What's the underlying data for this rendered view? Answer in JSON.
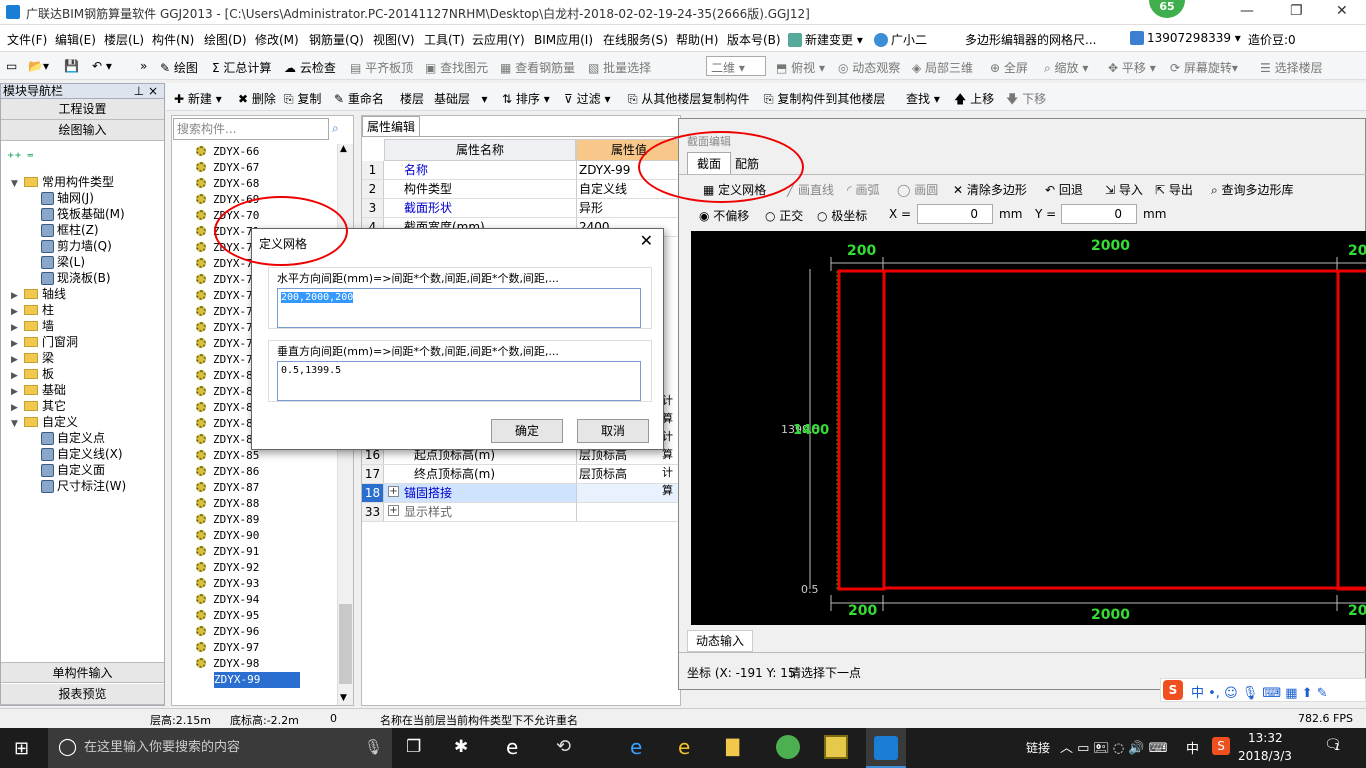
{
  "window": {
    "title": "广联达BIM钢筋算量软件 GGJ2013 - [C:\\Users\\Administrator.PC-20141127NRHM\\Desktop\\白龙村-2018-02-02-19-24-35(2666版).GGJ12]",
    "badge": "65"
  },
  "menu": [
    "文件(F)",
    "编辑(E)",
    "楼层(L)",
    "构件(N)",
    "绘图(D)",
    "修改(M)",
    "钢筋量(Q)",
    "视图(V)",
    "工具(T)",
    "云应用(Y)",
    "BIM应用(I)",
    "在线服务(S)",
    "帮助(H)",
    "版本号(B)",
    "新建变更",
    "广小二",
    "多边形编辑器的网格尺...",
    "13907298339",
    "造价豆:0"
  ],
  "toolbar1": [
    "绘图",
    "汇总计算",
    "云检查",
    "平齐板顶",
    "查找图元",
    "查看钢筋量",
    "批量选择",
    "二维",
    "俯视",
    "动态观察",
    "局部三维",
    "全屏",
    "缩放",
    "平移",
    "屏幕旋转",
    "选择楼层"
  ],
  "toolbar2": [
    "新建",
    "删除",
    "复制",
    "重命名",
    "楼层",
    "基础层",
    "排序",
    "过滤",
    "从其他楼层复制构件",
    "复制构件到其他楼层",
    "查找",
    "上移",
    "下移"
  ],
  "nav": {
    "title": "模块导航栏",
    "top_buttons": [
      "工程设置",
      "绘图输入"
    ],
    "bottom_buttons": [
      "单构件输入",
      "报表预览"
    ],
    "tree": [
      {
        "label": "常用构件类型",
        "level": 0,
        "exp": "▼"
      },
      {
        "label": "轴网(J)",
        "level": 1
      },
      {
        "label": "筏板基础(M)",
        "level": 1
      },
      {
        "label": "框柱(Z)",
        "level": 1
      },
      {
        "label": "剪力墙(Q)",
        "level": 1
      },
      {
        "label": "梁(L)",
        "level": 1
      },
      {
        "label": "现浇板(B)",
        "level": 1
      },
      {
        "label": "轴线",
        "level": 0,
        "exp": "▶"
      },
      {
        "label": "柱",
        "level": 0,
        "exp": "▶"
      },
      {
        "label": "墙",
        "level": 0,
        "exp": "▶"
      },
      {
        "label": "门窗洞",
        "level": 0,
        "exp": "▶"
      },
      {
        "label": "梁",
        "level": 0,
        "exp": "▶"
      },
      {
        "label": "板",
        "level": 0,
        "exp": "▶"
      },
      {
        "label": "基础",
        "level": 0,
        "exp": "▶"
      },
      {
        "label": "其它",
        "level": 0,
        "exp": "▶"
      },
      {
        "label": "自定义",
        "level": 0,
        "exp": "▼"
      },
      {
        "label": "自定义点",
        "level": 1
      },
      {
        "label": "自定义线(X)",
        "level": 1
      },
      {
        "label": "自定义面",
        "level": 1
      },
      {
        "label": "尺寸标注(W)",
        "level": 1
      }
    ]
  },
  "components": {
    "search_placeholder": "搜索构件...",
    "items": [
      "ZDYX-66",
      "ZDYX-67",
      "ZDYX-68",
      "ZDYX-69",
      "ZDYX-70",
      "ZDYX-71",
      "ZDYX-72",
      "ZDYX-73",
      "ZDYX-74",
      "ZDYX-75",
      "ZDYX-76",
      "ZDYX-77",
      "ZDYX-78",
      "ZDYX-79",
      "ZDYX-80",
      "ZDYX-81",
      "ZDYX-82",
      "ZDYX-83",
      "ZDYX-84",
      "ZDYX-85",
      "ZDYX-86",
      "ZDYX-87",
      "ZDYX-88",
      "ZDYX-89",
      "ZDYX-90",
      "ZDYX-91",
      "ZDYX-92",
      "ZDYX-93",
      "ZDYX-94",
      "ZDYX-95",
      "ZDYX-96",
      "ZDYX-97",
      "ZDYX-98",
      "ZDYX-99"
    ],
    "selected": "ZDYX-99"
  },
  "props": {
    "tab": "属性编辑",
    "col_name": "属性名称",
    "col_value": "属性值",
    "rows": [
      {
        "no": "1",
        "name": "名称",
        "value": "ZDYX-99",
        "blue": true
      },
      {
        "no": "2",
        "name": "构件类型",
        "value": "自定义线",
        "blue": false
      },
      {
        "no": "3",
        "name": "截面形状",
        "value": "异形",
        "blue": true
      },
      {
        "no": "4",
        "name": "截面宽度(mm)",
        "value": "2400",
        "blue": false
      },
      {
        "no": "16",
        "name": "起点顶标高(m)",
        "value": "层顶标高",
        "blue": false
      },
      {
        "no": "17",
        "name": "终点顶标高(m)",
        "value": "层顶标高",
        "blue": false
      },
      {
        "no": "18",
        "name": "锚固搭接",
        "value": "",
        "blue": false
      },
      {
        "no": "33",
        "name": "显示样式",
        "value": "",
        "blue": false
      }
    ],
    "partial_values": [
      "计算",
      "计算",
      "计算"
    ]
  },
  "editor": {
    "title": "截面编辑",
    "tabs": [
      "截面",
      "配筋"
    ],
    "tools": [
      "定义网格",
      "画直线",
      "画弧",
      "画圆",
      "清除多边形",
      "回退",
      "导入",
      "导出",
      "查询多边形库"
    ],
    "options": {
      "no_offset": "不偏移",
      "ortho": "正交",
      "polar": "极坐标",
      "x_label": "X =",
      "x_val": "0",
      "y_label": "Y =",
      "y_val": "0",
      "unit": "mm"
    },
    "dims_top": [
      "200",
      "2000",
      "20"
    ],
    "dims_bottom": [
      "200",
      "2000",
      "20"
    ],
    "dim_left": "1399.5",
    "dim_left_overlap": "1400",
    "dim_low": "0.5",
    "dynamic_input": "动态输入",
    "coord_label": "坐标 (X: -191 Y: 15",
    "prompt": "请选择下一点"
  },
  "dialog": {
    "title": "定义网格",
    "h_label": "水平方向间距(mm)=>间距*个数,间距,间距*个数,间距,...",
    "h_value": "200,2000,200",
    "v_label": "垂直方向间距(mm)=>间距*个数,间距,间距*个数,间距,...",
    "v_value": "0.5,1399.5",
    "ok": "确定",
    "cancel": "取消"
  },
  "status": {
    "floor_h": "层高:2.15m",
    "base_h": "底标高:-2.2m",
    "zero": "0",
    "msg": "名称在当前层当前构件类型下不允许重名",
    "fps": "782.6 FPS"
  },
  "taskbar": {
    "search": "在这里输入你要搜索的内容",
    "link": "链接",
    "ime": "中",
    "time": "13:32",
    "date": "2018/3/3",
    "notif": "1"
  },
  "colors": {
    "accent": "#0078d7",
    "red": "#ee0000",
    "green": "#33dd33",
    "select": "#2a6fcf"
  }
}
